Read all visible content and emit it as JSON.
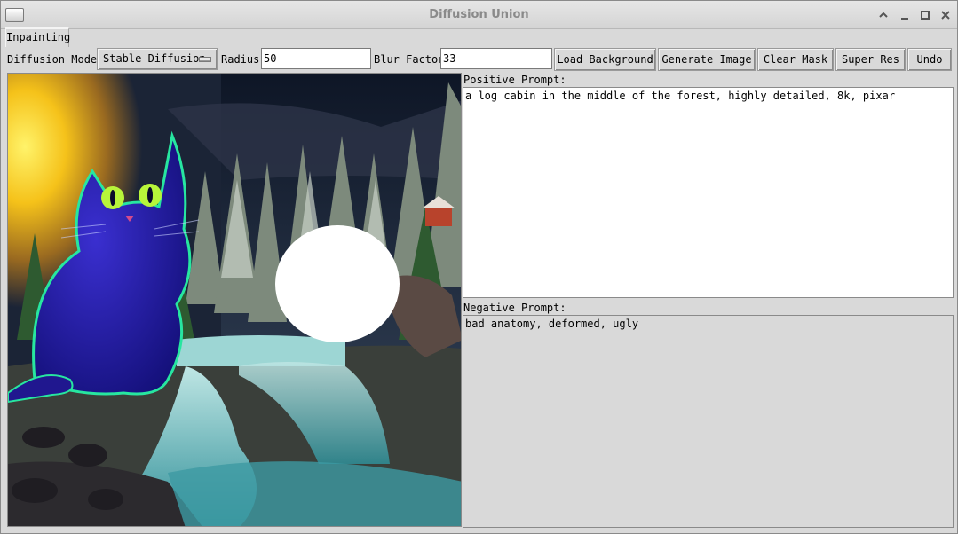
{
  "window": {
    "title": "Diffusion Union"
  },
  "tabs": [
    {
      "label": "Inpainting"
    }
  ],
  "toolbar": {
    "model_label": "Diffusion Model:",
    "model_value": "Stable Diffusion",
    "radius_label": "Radius:",
    "radius_value": "50",
    "blur_label": "Blur Factor:",
    "blur_value": "33",
    "buttons": [
      {
        "label": "Load Background"
      },
      {
        "label": "Generate Image"
      },
      {
        "label": "Clear Mask"
      },
      {
        "label": "Super Res"
      },
      {
        "label": "Undo"
      }
    ]
  },
  "prompts": {
    "positive_label": "Positive Prompt:",
    "positive_value": "a log cabin in the middle of the forest, highly detailed, 8k, pixar",
    "negative_label": "Negative Prompt:",
    "negative_value": "bad anatomy, deformed, ugly"
  },
  "canvas": {
    "content": "generated image: blue cat beside forest waterfall with white circular inpainting mask",
    "mask_color": "#ffffff",
    "cat_color": "#2a1fa8",
    "cat_glow": "#27e6a0",
    "cat_eye_color": "#b8f53a"
  }
}
